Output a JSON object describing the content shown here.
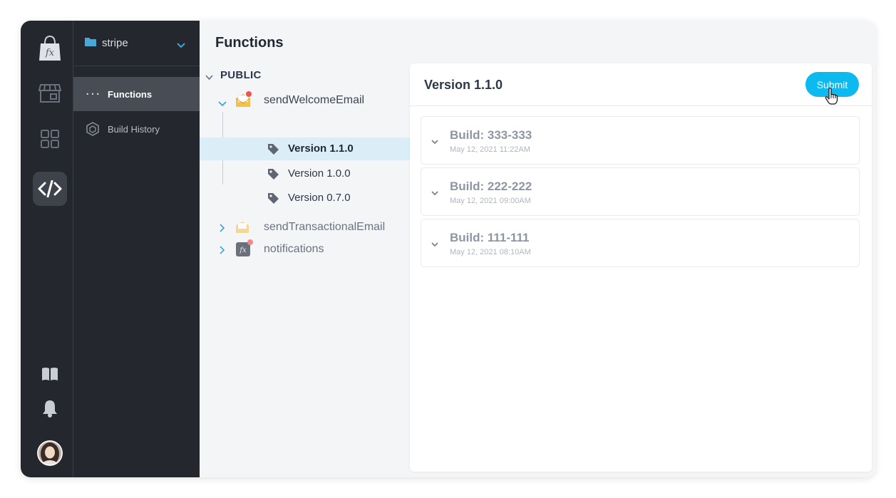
{
  "project": {
    "name": "stripe"
  },
  "sidebar": {
    "items": [
      {
        "label": "Functions"
      },
      {
        "label": "Build History"
      }
    ]
  },
  "page": {
    "title": "Functions"
  },
  "tree": {
    "section": "PUBLIC",
    "functions": [
      {
        "name": "sendWelcomeEmail",
        "versions": [
          "Version 1.1.0",
          "Version 1.0.0",
          "Version 0.7.0"
        ]
      },
      {
        "name": "sendTransactionalEmail"
      },
      {
        "name": "notifications"
      }
    ]
  },
  "detail": {
    "title": "Version 1.1.0",
    "submit_label": "Submit",
    "builds": [
      {
        "title": "Build: 333-333",
        "date": "May 12, 2021 11:22AM"
      },
      {
        "title": "Build: 222-222",
        "date": "May 12, 2021 09:00AM"
      },
      {
        "title": "Build: 111-111",
        "date": "May 12, 2021 08:10AM"
      }
    ]
  },
  "colors": {
    "accent": "#0dbaf0",
    "rail": "#24272d",
    "selected_row": "#dbeef7",
    "notification_dot": "#f05252"
  }
}
